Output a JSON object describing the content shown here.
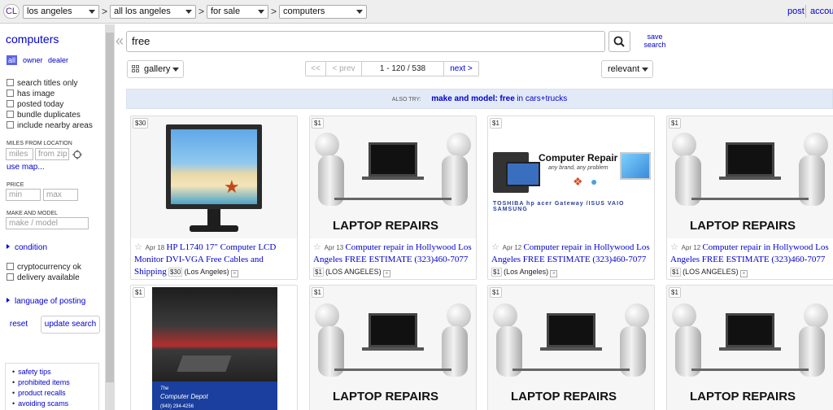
{
  "topbar": {
    "logo": "CL",
    "selects": [
      "los angeles",
      "all los angeles",
      "for sale",
      "computers"
    ],
    "post": "post",
    "account": "account"
  },
  "sidebar": {
    "title": "computers",
    "segments": [
      "all",
      "owner",
      "dealer"
    ],
    "checkboxes": [
      "search titles only",
      "has image",
      "posted today",
      "bundle duplicates",
      "include nearby areas"
    ],
    "miles_label": "MILES FROM LOCATION",
    "miles_placeholder": "miles",
    "zip_placeholder": "from zip",
    "use_map": "use map...",
    "price_label": "PRICE",
    "min_placeholder": "min",
    "max_placeholder": "max",
    "make_label": "MAKE AND MODEL",
    "make_placeholder": "make / model",
    "condition": "condition",
    "checkboxes2": [
      "cryptocurrency ok",
      "delivery available"
    ],
    "language": "language of posting",
    "reset": "reset",
    "update": "update search",
    "safety_links": [
      "safety tips",
      "prohibited items",
      "product recalls",
      "avoiding scams"
    ]
  },
  "search": {
    "value": "free",
    "save_line1": "save",
    "save_line2": "search"
  },
  "toolbar": {
    "view": "gallery",
    "first": "<<",
    "prev": "< prev",
    "range": "1 - 120 / 538",
    "next": "next >",
    "sort": "relevant"
  },
  "also_try": {
    "label": "ALSO TRY:",
    "bold": "make and model:",
    "term": "free",
    "rest": "in cars+trucks"
  },
  "cards": [
    {
      "price": "$30",
      "date": "Apr 18",
      "title": "HP L1740 17\" Computer LCD Monitor DVI-VGA Free Cables and Shipping",
      "hood": "(Los Angeles)"
    },
    {
      "price": "$1",
      "date": "Apr 13",
      "title": "Computer repair in Hollywood Los Angeles FREE ESTIMATE (323)460-7077",
      "hood": "(LOS ANGELES)"
    },
    {
      "price": "$1",
      "date": "Apr 12",
      "title": "Computer repair in Hollywood Los Angeles FREE ESTIMATE (323)460-7077",
      "hood": "(Los Angeles)"
    },
    {
      "price": "$1",
      "date": "Apr 12",
      "title": "Computer repair in Hollywood Los Angeles FREE ESTIMATE (323)460-7077",
      "hood": "(LOS ANGELES)"
    },
    {
      "price": "$1"
    },
    {
      "price": "$1"
    },
    {
      "price": "$1"
    },
    {
      "price": "$1"
    }
  ],
  "art": {
    "laptop_caption": "LAPTOP REPAIRS",
    "cr_title": "Computer Repair",
    "cr_sub": "any brand, any problem",
    "cr_logos": "TOSHIBA  hp  acer  Gateway  /ISUS  VAIO  SAMSUNG",
    "depot_the": "The",
    "depot_name": "Computer Depot",
    "depot_phone": "(949) 294-4256"
  }
}
